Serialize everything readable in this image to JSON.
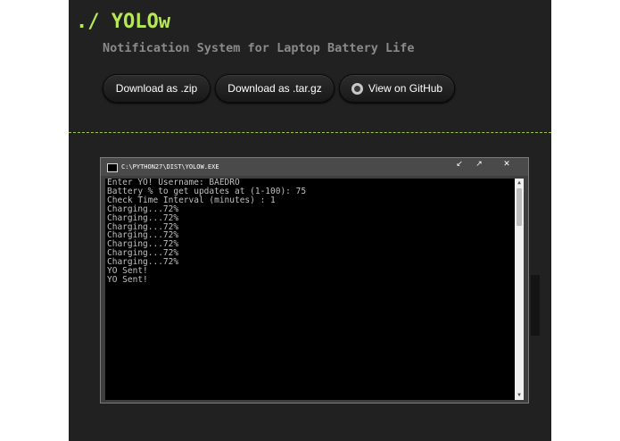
{
  "header": {
    "title": "./ YOLOw",
    "tagline": "Notification System for Laptop Battery Life"
  },
  "buttons": {
    "zip": "Download as .zip",
    "targz": "Download as .tar.gz",
    "github": "View on GitHub"
  },
  "console": {
    "window_title": "C:\\PYTHON27\\DIST\\YOLOW.EXE",
    "controls": {
      "minimize": "↙",
      "maximize": "↗",
      "close": "✕"
    },
    "lines": "Enter YO! Username: BAEDRO\nBattery % to get updates at (1-100): 75\nCheck Time Interval (minutes) : 1\nCharging...72%\nCharging...72%\nCharging...72%\nCharging...72%\nCharging...72%\nCharging...72%\nCharging...72%\nYO Sent!\nYO Sent!"
  },
  "colors": {
    "accent": "#b5e853",
    "background": "#212121",
    "console_bg": "#000000",
    "console_text": "#c0c0c0"
  },
  "icons": {
    "github": "github-icon",
    "app": "console-app-icon"
  }
}
